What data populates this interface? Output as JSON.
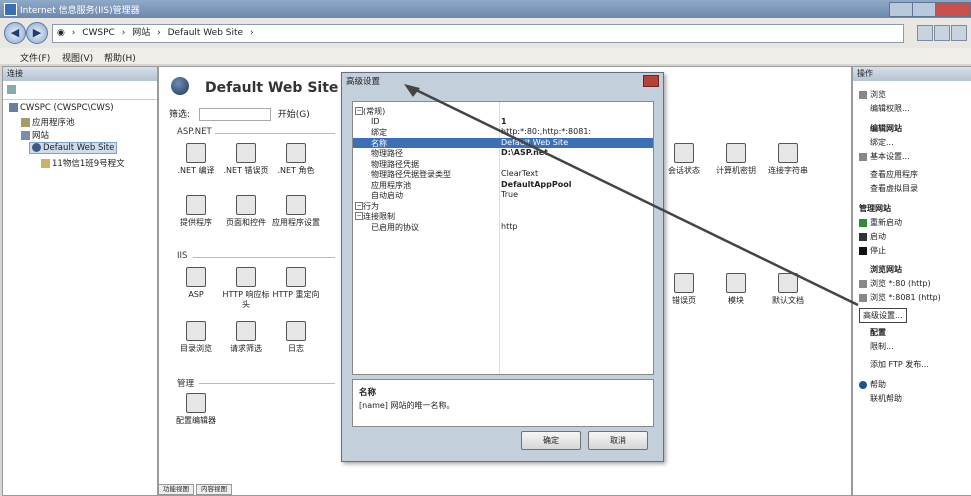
{
  "window": {
    "title": "Internet 信息服务(IIS)管理器"
  },
  "address": {
    "crumbs": [
      "CWSPC",
      "网站",
      "Default Web Site"
    ]
  },
  "menu": [
    "文件(F)",
    "视图(V)",
    "帮助(H)"
  ],
  "left_panel": {
    "header": "连接",
    "tree": [
      {
        "label": "CWSPC (CWSPC\\CWS)",
        "selected": false
      },
      {
        "label": "应用程序池",
        "selected": false
      },
      {
        "label": "网站",
        "selected": false
      },
      {
        "label": "Default Web Site",
        "selected": true
      },
      {
        "label": "11物信1班9号程文",
        "selected": false
      }
    ]
  },
  "main": {
    "title": "Default Web Site 主页",
    "filter_label": "筛选:",
    "start_button": "开始(G)",
    "sections": [
      {
        "name": "ASP.NET",
        "items": [
          ".NET 编译",
          ".NET 错误页",
          ".NET 角色",
          "提供程序",
          "页面和控件",
          "应用程序设置"
        ]
      },
      {
        "name": "IIS",
        "items": [
          "ASP",
          "HTTP 响应标头",
          "HTTP 重定向",
          "目录浏览",
          "请求筛选",
          "日志"
        ]
      },
      {
        "name": "管理",
        "items": [
          "配置编辑器"
        ]
      }
    ],
    "right_icons": [
      "会话状态",
      "计算机密钥",
      "连接字符串",
      "错误页",
      "模块",
      "默认文档"
    ]
  },
  "right_panel": {
    "header": "操作",
    "actions": [
      {
        "label": "浏览",
        "type": "item"
      },
      {
        "label": "编辑权限...",
        "type": "item"
      },
      {
        "label": "编辑网站",
        "type": "head"
      },
      {
        "label": "绑定...",
        "type": "item"
      },
      {
        "label": "基本设置...",
        "type": "item"
      },
      {
        "label": "查看应用程序",
        "type": "item"
      },
      {
        "label": "查看虚拟目录",
        "type": "item"
      },
      {
        "label": "管理网站",
        "type": "head"
      },
      {
        "label": "重新启动",
        "type": "item"
      },
      {
        "label": "启动",
        "type": "item"
      },
      {
        "label": "停止",
        "type": "item"
      },
      {
        "label": "浏览网站",
        "type": "head"
      },
      {
        "label": "浏览 *:80 (http)",
        "type": "item"
      },
      {
        "label": "浏览 *:8081 (http)",
        "type": "item"
      },
      {
        "label": "高级设置...",
        "type": "highlight"
      },
      {
        "label": "配置",
        "type": "head"
      },
      {
        "label": "限制...",
        "type": "item"
      },
      {
        "label": "添加 FTP 发布...",
        "type": "item"
      },
      {
        "label": "帮助",
        "type": "item"
      },
      {
        "label": "联机帮助",
        "type": "item"
      }
    ]
  },
  "dialog": {
    "title": "高级设置",
    "properties": [
      {
        "key": "(常规)",
        "value": "",
        "category": true,
        "selected": false
      },
      {
        "key": "ID",
        "value": "1",
        "category": false,
        "selected": false
      },
      {
        "key": "绑定",
        "value": "http:*:80:,http:*:8081:",
        "category": false,
        "selected": false
      },
      {
        "key": "名称",
        "value": "Default Web Site",
        "category": false,
        "selected": true
      },
      {
        "key": "物理路径",
        "value": "D:\\ASP.net",
        "category": false,
        "selected": false
      },
      {
        "key": "物理路径凭据",
        "value": "",
        "category": false,
        "selected": false
      },
      {
        "key": "物理路径凭据登录类型",
        "value": "ClearText",
        "category": false,
        "selected": false
      },
      {
        "key": "应用程序池",
        "value": "DefaultAppPool",
        "category": false,
        "selected": false
      },
      {
        "key": "自动启动",
        "value": "True",
        "category": false,
        "selected": false
      },
      {
        "key": "行为",
        "value": "",
        "category": true,
        "selected": false
      },
      {
        "key": "连接限制",
        "value": "",
        "category": true,
        "selected": false
      },
      {
        "key": "已启用的协议",
        "value": "http",
        "category": false,
        "selected": false
      }
    ],
    "desc_heading": "名称",
    "desc_text": "[name] 网站的唯一名称。",
    "ok": "确定",
    "cancel": "取消"
  },
  "bottom_tabs": [
    "功能视图",
    "内容视图"
  ]
}
